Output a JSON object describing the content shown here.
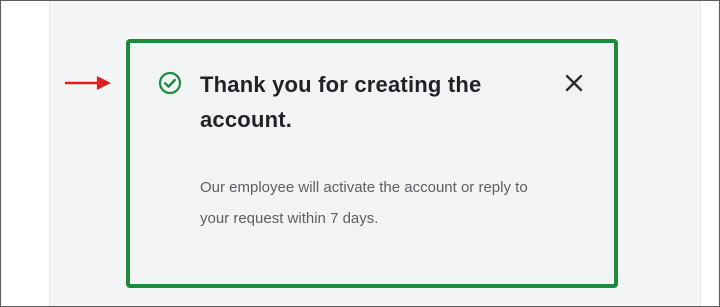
{
  "notification": {
    "title": "Thank you for creating the account.",
    "message": "Our employee will activate the account or reply to your request within 7 days.",
    "status_icon": "check-circle-icon",
    "close_icon": "close-icon",
    "accent_color": "#1e8a3c"
  },
  "annotation": {
    "arrow_icon": "arrow-right-icon",
    "arrow_color": "#e02020"
  }
}
